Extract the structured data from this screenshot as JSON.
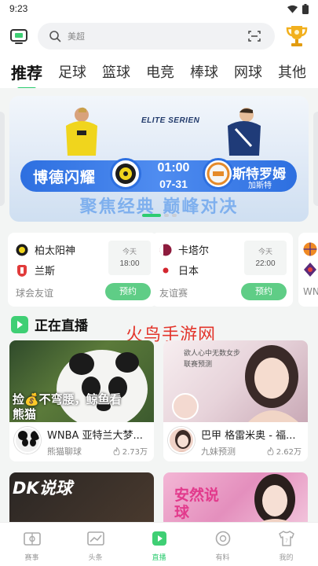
{
  "status_bar": {
    "time": "9:23"
  },
  "header": {
    "search_placeholder": "美超",
    "icons": {
      "tv": "tv-icon",
      "search": "search-icon",
      "scan": "scan-icon",
      "trophy": "trophy-icon"
    }
  },
  "tabs": [
    {
      "label": "推荐",
      "active": true
    },
    {
      "label": "足球"
    },
    {
      "label": "篮球"
    },
    {
      "label": "电竞"
    },
    {
      "label": "棒球"
    },
    {
      "label": "网球"
    },
    {
      "label": "其他"
    }
  ],
  "banner": {
    "league": "ELITE SERIEN",
    "team_left": "博德闪耀",
    "team_right": "斯特罗姆",
    "team_right_sub": "加斯特",
    "time": "01:00",
    "date": "07-31",
    "slogan": "聚焦经典 巅峰对决",
    "page_count": 3,
    "active_page": 0
  },
  "matches": [
    {
      "home": "柏太阳神",
      "away": "兰斯",
      "league": "球会友谊",
      "day": "今天",
      "time": "18:00",
      "button": "预约"
    },
    {
      "home": "卡塔尔",
      "away": "日本",
      "league": "友谊赛",
      "day": "今天",
      "time": "22:00",
      "button": "预约"
    },
    {
      "league": "WNBA"
    }
  ],
  "live": {
    "title": "正在直播",
    "watermark": "火鸟手游网",
    "streams": [
      {
        "title": "WNBA 亚特兰大梦...",
        "author": "熊猫聊球",
        "heat": "2.73万",
        "thumb_text": "捡💰不弯腰，鲸鱼看熊猫"
      },
      {
        "title": "巴甲  格雷米奥 - 福...",
        "author": "九妹预测",
        "heat": "2.62万",
        "thumb_text": "欲人心中无数女步\n联赛预测"
      },
      {
        "tag": "DK说球"
      },
      {
        "tag": "安然说球"
      }
    ]
  },
  "bottom_nav": [
    {
      "label": "赛事",
      "icon": "scoreboard-icon"
    },
    {
      "label": "头条",
      "icon": "chart-icon"
    },
    {
      "label": "直播",
      "icon": "live-play-icon",
      "active": true
    },
    {
      "label": "有料",
      "icon": "compass-icon"
    },
    {
      "label": "我的",
      "icon": "jersey-icon"
    }
  ],
  "colors": {
    "accent": "#2ecc71",
    "banner_blue": "#2d6fe0",
    "watermark_red": "#e3352b"
  }
}
